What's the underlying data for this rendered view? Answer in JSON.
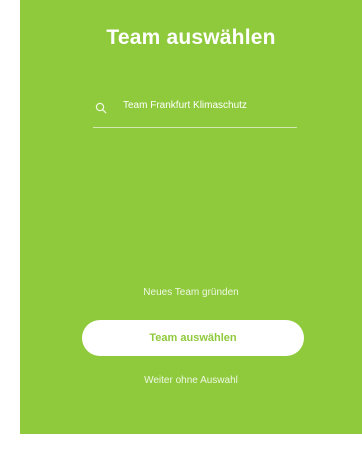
{
  "header": {
    "title": "Team auswählen"
  },
  "search": {
    "icon": "search-icon",
    "value": "Team Frankfurt Klimaschutz"
  },
  "actions": {
    "new_team_label": "Neues Team gründen",
    "select_button_label": "Team auswählen",
    "skip_label": "Weiter ohne Auswahl"
  },
  "colors": {
    "panel_background": "#8fca3d",
    "button_background": "#ffffff",
    "button_text": "#8fca3d"
  }
}
